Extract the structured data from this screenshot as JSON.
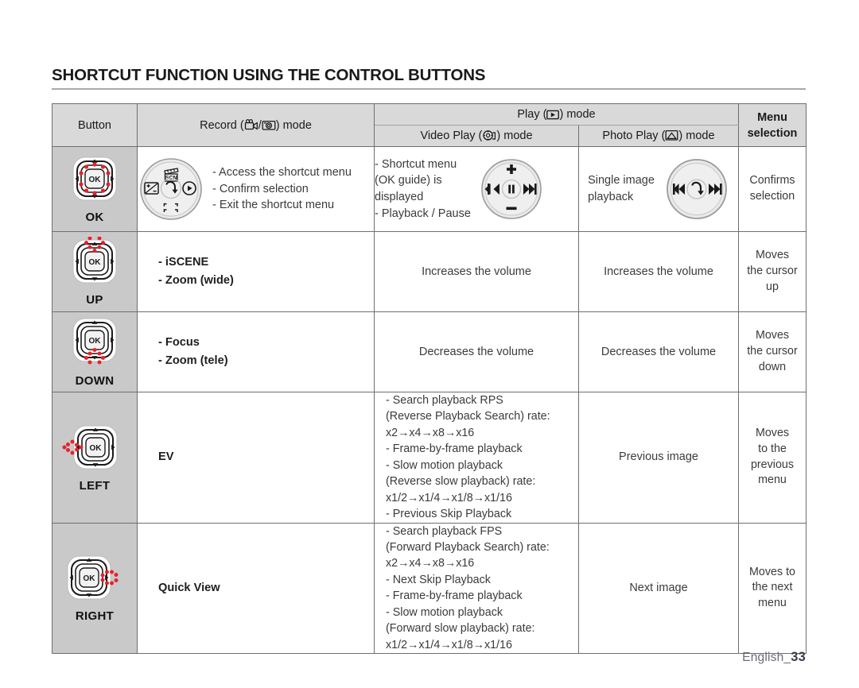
{
  "page": {
    "title": "SHORTCUT FUNCTION USING THE CONTROL BUTTONS",
    "footer_text": "English_",
    "footer_page": "33"
  },
  "table": {
    "headers": {
      "button": "Button",
      "record_pre": "Record (",
      "record_sep": "/",
      "record_post": ") mode",
      "play_pre": "Play (",
      "play_post": ") mode",
      "video_pre": "Video Play (",
      "video_post": ") mode",
      "photo_pre": "Photo Play (",
      "photo_post": ") mode",
      "menu": "Menu\nselection"
    },
    "icons": {
      "camcorder": "camcorder-icon",
      "camera": "camera-icon",
      "play": "play-icon",
      "video_play": "film-reel-icon",
      "photo_play": "photo-icon"
    },
    "rows": [
      {
        "button_label": "OK",
        "button_icon": "dpad-ok-highlight-icon",
        "record_widget": "record-mode-wheel",
        "record_text": "- Access the shortcut menu\n- Confirm selection\n- Exit the shortcut menu",
        "record_bold": false,
        "video_text": "- Shortcut menu\n   (OK guide) is\n   displayed\n- Playback / Pause",
        "video_widget": "video-playback-wheel",
        "photo_text": "Single image\nplayback",
        "photo_widget": "photo-playback-wheel",
        "menu_text": "Confirms\nselection"
      },
      {
        "button_label": "UP",
        "button_icon": "dpad-up-highlight-icon",
        "record_text": "- iSCENE\n- Zoom (wide)",
        "record_bold": true,
        "video_text": "Increases the volume",
        "photo_text": "Increases the volume",
        "menu_text": "Moves\nthe cursor\nup"
      },
      {
        "button_label": "DOWN",
        "button_icon": "dpad-down-highlight-icon",
        "record_text": "- Focus\n- Zoom (tele)",
        "record_bold": true,
        "video_text": "Decreases the volume",
        "photo_text": "Decreases the volume",
        "menu_text": "Moves\nthe cursor\ndown"
      },
      {
        "button_label": "LEFT",
        "button_icon": "dpad-left-highlight-icon",
        "record_text": "EV",
        "record_bold": true,
        "video_text": "- Search playback RPS\n   (Reverse Playback Search) rate:\n   x2→x4→x8→x16\n- Frame-by-frame playback\n- Slow motion playback\n   (Reverse slow playback) rate:\n   x1/2→x1/4→x1/8→x1/16\n- Previous Skip Playback",
        "photo_text": "Previous image",
        "menu_text": "Moves\nto the\nprevious\nmenu"
      },
      {
        "button_label": "RIGHT",
        "button_icon": "dpad-right-highlight-icon",
        "record_text": "Quick View",
        "record_bold": true,
        "video_text": "- Search playback FPS\n   (Forward Playback Search) rate:\n   x2→x4→x8→x16\n- Next Skip Playback\n- Frame-by-frame playback\n- Slow motion playback\n   (Forward slow playback) rate:\n   x1/2→x1/4→x1/8→x1/16",
        "photo_text": "Next image",
        "menu_text": "Moves to\nthe next\nmenu"
      }
    ]
  },
  "colors": {
    "header_bg": "#d9d9d9",
    "button_col_bg": "#c9c9c9",
    "border": "#6e6e72",
    "highlight_red": "#e8222a",
    "text": "#3b3b3f",
    "rule": "#a9a9ad"
  }
}
